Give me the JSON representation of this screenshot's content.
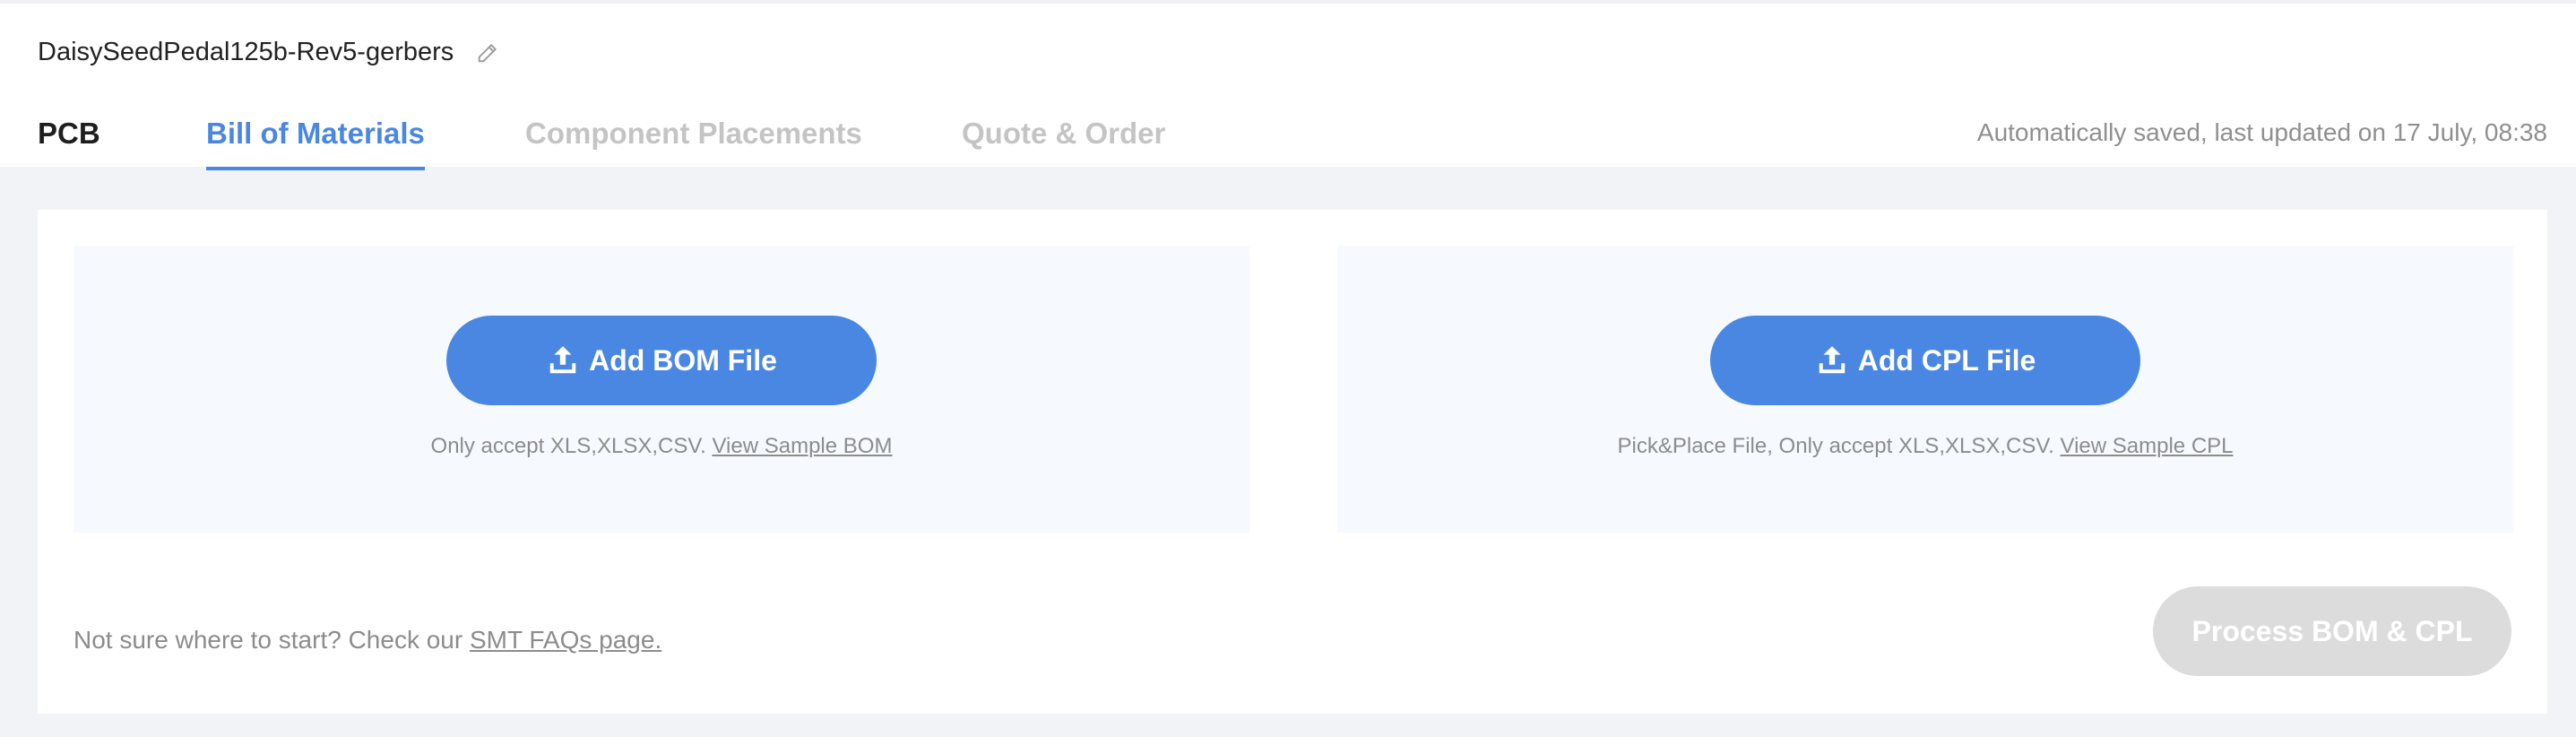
{
  "project": {
    "name": "DaisySeedPedal125b-Rev5-gerbers",
    "edit_icon": "pencil-icon"
  },
  "tabs": [
    {
      "label": "PCB",
      "state": "completed"
    },
    {
      "label": "Bill of Materials",
      "state": "active"
    },
    {
      "label": "Component Placements",
      "state": "disabled"
    },
    {
      "label": "Quote & Order",
      "state": "disabled"
    }
  ],
  "save_status": "Automatically saved, last updated on 17 July, 08:38",
  "bom_panel": {
    "button_label": "Add BOM File",
    "note": "Only accept XLS,XLSX,CSV.",
    "sample_link": "View Sample BOM",
    "icon": "upload-icon"
  },
  "cpl_panel": {
    "button_label": "Add CPL File",
    "note": "Pick&Place File, Only accept XLS,XLSX,CSV.",
    "sample_link": "View Sample CPL",
    "icon": "upload-icon"
  },
  "help": {
    "text": "Not sure where to start? Check our",
    "link": "SMT FAQs page."
  },
  "process_button": {
    "label": "Process BOM & CPL",
    "enabled": false
  },
  "colors": {
    "accent": "#4a87e3",
    "disabled_button": "#dcdcdc",
    "panel_bg": "#f6f9fd",
    "page_bg": "#f1f3f6"
  }
}
